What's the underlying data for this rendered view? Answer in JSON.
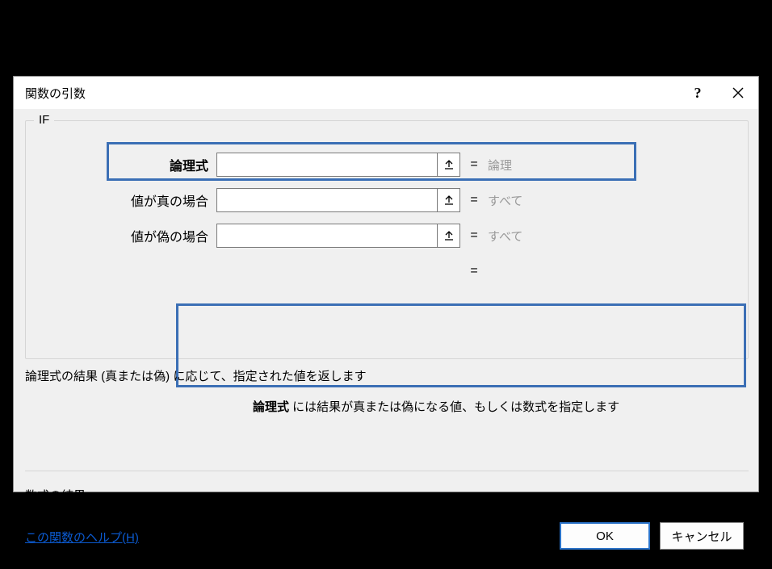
{
  "dialog": {
    "title": "関数の引数",
    "function_name": "IF",
    "help_glyph": "?",
    "args": [
      {
        "label": "論理式",
        "value": "",
        "hint": "論理",
        "bold": true
      },
      {
        "label": "値が真の場合",
        "value": "",
        "hint": "すべて",
        "bold": false
      },
      {
        "label": "値が偽の場合",
        "value": "",
        "hint": "すべて",
        "bold": false
      }
    ],
    "eq": "=",
    "description": "論理式の結果 (真または偽) に応じて、指定された値を返します",
    "arg_help": {
      "name": "論理式",
      "text": " には結果が真または偽になる値、もしくは数式を指定します"
    },
    "result_label": "数式の結果 =",
    "help_link": "この関数のヘルプ(H)",
    "buttons": {
      "ok": "OK",
      "cancel": "キャンセル"
    }
  }
}
